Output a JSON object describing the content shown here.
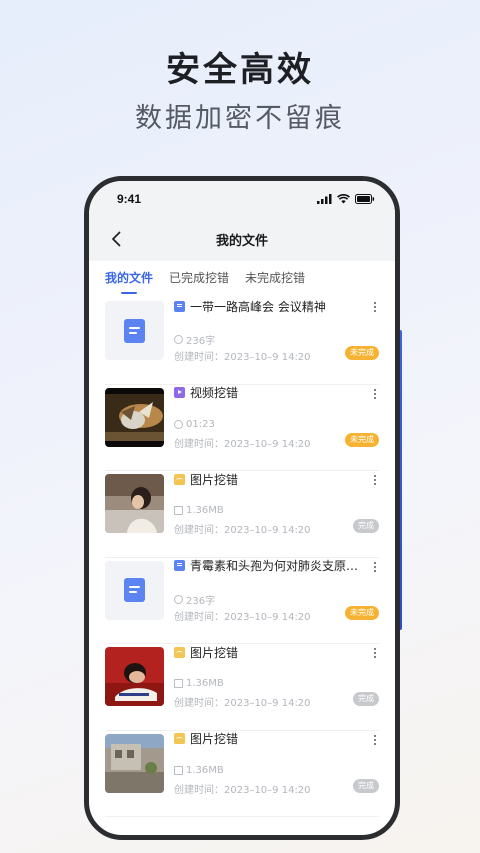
{
  "promo": {
    "headline": "安全高效",
    "subhead": "数据加密不留痕"
  },
  "status_bar": {
    "time": "9:41"
  },
  "nav": {
    "back_icon": "chevron-left-icon",
    "title": "我的文件"
  },
  "tabs": [
    {
      "label": "我的文件",
      "active": true
    },
    {
      "label": "已完成挖错",
      "active": false
    },
    {
      "label": "未完成挖错",
      "active": false
    }
  ],
  "files": [
    {
      "type": "doc",
      "title": "一带一路高峰会 会议精神",
      "meta_icon": "text-count-icon",
      "meta": "236字",
      "date": "创建时间：2023–10–9 14:20",
      "status": "未完成",
      "status_kind": "pending"
    },
    {
      "type": "video",
      "title": "视频挖错",
      "meta_icon": "clock-icon",
      "meta": "01:23",
      "date": "创建时间：2023–10–9 14:20",
      "status": "未完成",
      "status_kind": "pending"
    },
    {
      "type": "image",
      "title": "图片挖错",
      "meta_icon": "image-icon",
      "meta": "1.36MB",
      "date": "创建时间：2023–10–9 14:20",
      "status": "完成",
      "status_kind": "done"
    },
    {
      "type": "doc",
      "title": "青霉素和头孢为何对肺炎支原体...",
      "meta_icon": "text-count-icon",
      "meta": "236字",
      "date": "创建时间：2023–10–9 14:20",
      "status": "未完成",
      "status_kind": "pending"
    },
    {
      "type": "image",
      "title": "图片挖错",
      "meta_icon": "image-icon",
      "meta": "1.36MB",
      "date": "创建时间：2023–10–9 14:20",
      "status": "完成",
      "status_kind": "done"
    },
    {
      "type": "image",
      "title": "图片挖错",
      "meta_icon": "image-icon",
      "meta": "1.36MB",
      "date": "创建时间：2023–10–9 14:20",
      "status": "完成",
      "status_kind": "done"
    }
  ],
  "colors": {
    "accent": "#3b67e3",
    "pending": "#f6b333",
    "done": "#c7c9cd"
  }
}
